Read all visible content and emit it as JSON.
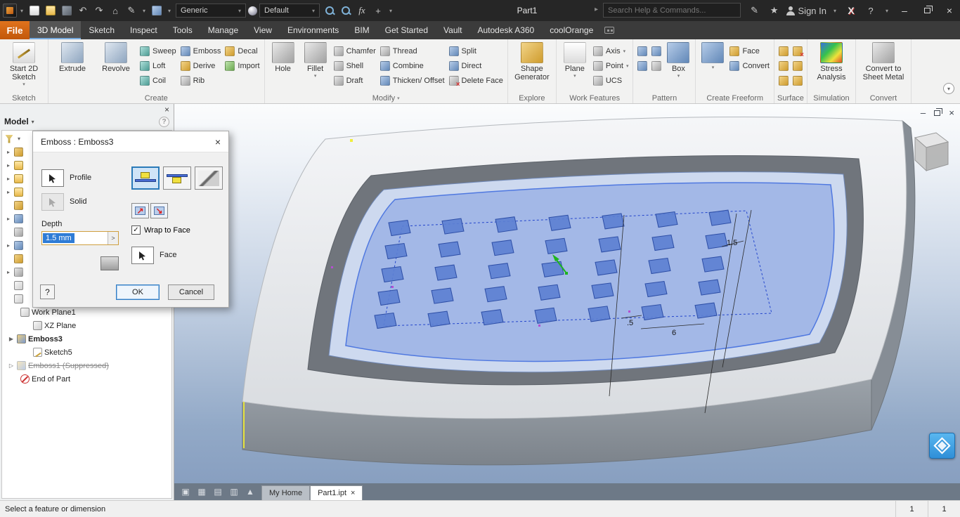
{
  "titlebar": {
    "doc_title": "Part1",
    "material": "Generic",
    "appearance": "Default",
    "fx": "fx",
    "search_placeholder": "Search Help & Commands...",
    "sign_in": "Sign In"
  },
  "ribbon_tabs": {
    "file": "File",
    "items": [
      "3D Model",
      "Sketch",
      "Inspect",
      "Tools",
      "Manage",
      "View",
      "Environments",
      "BIM",
      "Get Started",
      "Vault",
      "Autodesk A360",
      "coolOrange"
    ]
  },
  "ribbon": {
    "sketch": {
      "label": "Sketch",
      "start2d": "Start 2D Sketch"
    },
    "create": {
      "label": "Create",
      "extrude": "Extrude",
      "revolve": "Revolve",
      "sweep": "Sweep",
      "loft": "Loft",
      "coil": "Coil",
      "emboss": "Emboss",
      "derive": "Derive",
      "rib": "Rib",
      "decal": "Decal",
      "import": "Import"
    },
    "modify": {
      "label": "Modify",
      "hole": "Hole",
      "fillet": "Fillet",
      "chamfer": "Chamfer",
      "shell": "Shell",
      "draft": "Draft",
      "thread": "Thread",
      "combine": "Combine",
      "thicken": "Thicken/ Offset",
      "split": "Split",
      "direct": "Direct",
      "delete_face": "Delete Face"
    },
    "explore": {
      "label": "Explore",
      "shape_generator": "Shape Generator"
    },
    "work_features": {
      "label": "Work Features",
      "plane": "Plane",
      "axis": "Axis",
      "point": "Point",
      "ucs": "UCS"
    },
    "pattern": {
      "label": "Pattern",
      "box": "Box"
    },
    "freeform": {
      "label": "Create Freeform",
      "face": "Face",
      "convert": "Convert"
    },
    "surface": {
      "label": "Surface"
    },
    "simulation": {
      "label": "Simulation",
      "stress": "Stress Analysis"
    },
    "convert": {
      "label": "Convert",
      "sheet_metal": "Convert to Sheet Metal"
    }
  },
  "browser": {
    "header": "Model",
    "items": [
      {
        "label": "Work Plane1"
      },
      {
        "label": "XZ Plane"
      },
      {
        "label": "Emboss3"
      },
      {
        "label": "Sketch5"
      },
      {
        "label": "Emboss1 (Suppressed)"
      },
      {
        "label": "End of Part"
      }
    ]
  },
  "dialog": {
    "title": "Emboss : Emboss3",
    "profile": "Profile",
    "solid": "Solid",
    "depth": "Depth",
    "depth_value": "1.5 mm",
    "wrap_to_face": "Wrap to Face",
    "face": "Face",
    "ok": "OK",
    "cancel": "Cancel",
    "help": "?"
  },
  "viewport": {
    "dims": {
      "d1": "1.5",
      "d2": "6",
      "d3": ".5"
    },
    "emboss_grid": {
      "rows": 5,
      "cols": 7
    },
    "doc_tabs": [
      {
        "label": "My Home"
      },
      {
        "label": "Part1.ipt"
      }
    ]
  },
  "statusbar": {
    "message": "Select a feature or dimension",
    "counter1": "1",
    "counter2": "1"
  }
}
